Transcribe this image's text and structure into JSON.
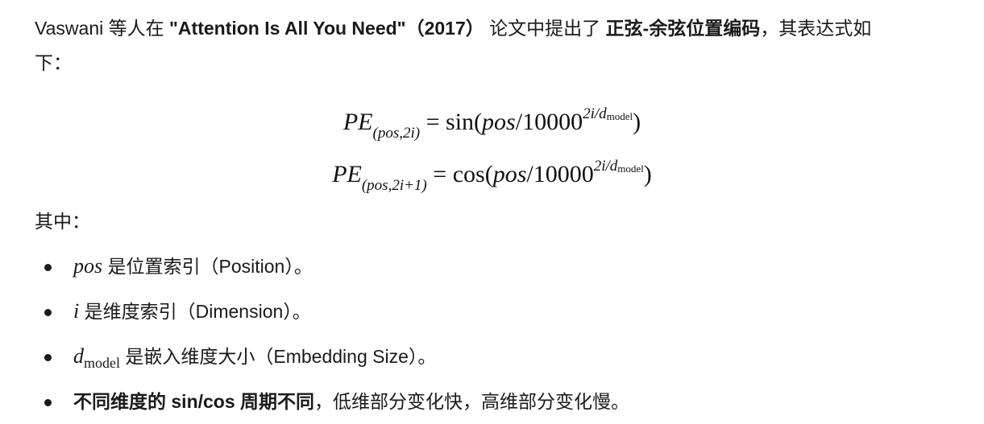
{
  "intro": {
    "part1": "Vaswani 等人在 ",
    "paper_title": "\"Attention Is All You Need\"（2017）",
    "part2": " 论文中提出了 ",
    "term": "正弦-余弦位置编码",
    "part3": "，其表达式如",
    "part4": "下："
  },
  "formulas": {
    "f1": {
      "lhs": "PE",
      "lhs_sub": "(pos,2i)",
      "eq": "=",
      "func": "sin",
      "open": "(",
      "arg": "pos",
      "slash": "/",
      "base": "10000",
      "exp_main": "2i/d",
      "exp_sub": "model",
      "close": ")"
    },
    "f2": {
      "lhs": "PE",
      "lhs_sub": "(pos,2i+1)",
      "eq": "=",
      "func": "cos",
      "open": "(",
      "arg": "pos",
      "slash": "/",
      "base": "10000",
      "exp_main": "2i/d",
      "exp_sub": "model",
      "close": ")"
    }
  },
  "where_label": "其中：",
  "bullets": [
    {
      "var": "pos",
      "var_sub": "",
      "text": " 是位置索引（Position）。"
    },
    {
      "var": "i",
      "var_sub": "",
      "text": " 是维度索引（Dimension）。"
    },
    {
      "var": "d",
      "var_sub": "model",
      "text": " 是嵌入维度大小（Embedding Size）。"
    },
    {
      "bold_text": "不同维度的 sin/cos 周期不同",
      "text": "，低维部分变化快，高维部分变化慢。"
    }
  ]
}
